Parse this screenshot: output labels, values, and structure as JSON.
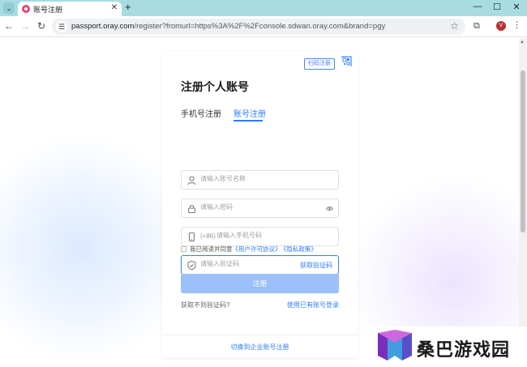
{
  "browser": {
    "tab_title": "账号注册",
    "new_tab_label": "+",
    "url_host": "passport.oray.com",
    "url_path": "/register?fromurl=https%3A%2F%2Fconsole.sdwan.oray.com&brand=pgy",
    "profile_initial": "V"
  },
  "card": {
    "scan_tag": "扫码注册",
    "title": "注册个人账号",
    "tabs": [
      {
        "label": "手机号注册",
        "active": false
      },
      {
        "label": "账号注册",
        "active": true
      }
    ],
    "fields": {
      "account_placeholder": "请输入账号名称",
      "password_placeholder": "请输入密码",
      "phone_prefix": "(+86)",
      "phone_placeholder": "请输入手机号码",
      "code_placeholder": "请输入验证码",
      "get_code_label": "获取验证码"
    },
    "agreement": {
      "prefix": "我已阅读并同意",
      "user_license": "《用户许可协议》",
      "privacy_policy": "《隐私政策》"
    },
    "submit_label": "注册",
    "no_code_label": "获取不到验证码?",
    "login_existing_label": "使用已有账号登录",
    "switch_enterprise_label": "切换到企业账号注册"
  },
  "watermark": {
    "text": "桑巴游戏园"
  },
  "colors": {
    "accent": "#2f7cf6",
    "submit_disabled": "#9bc0fa",
    "tabbar": "#a7dde2"
  }
}
